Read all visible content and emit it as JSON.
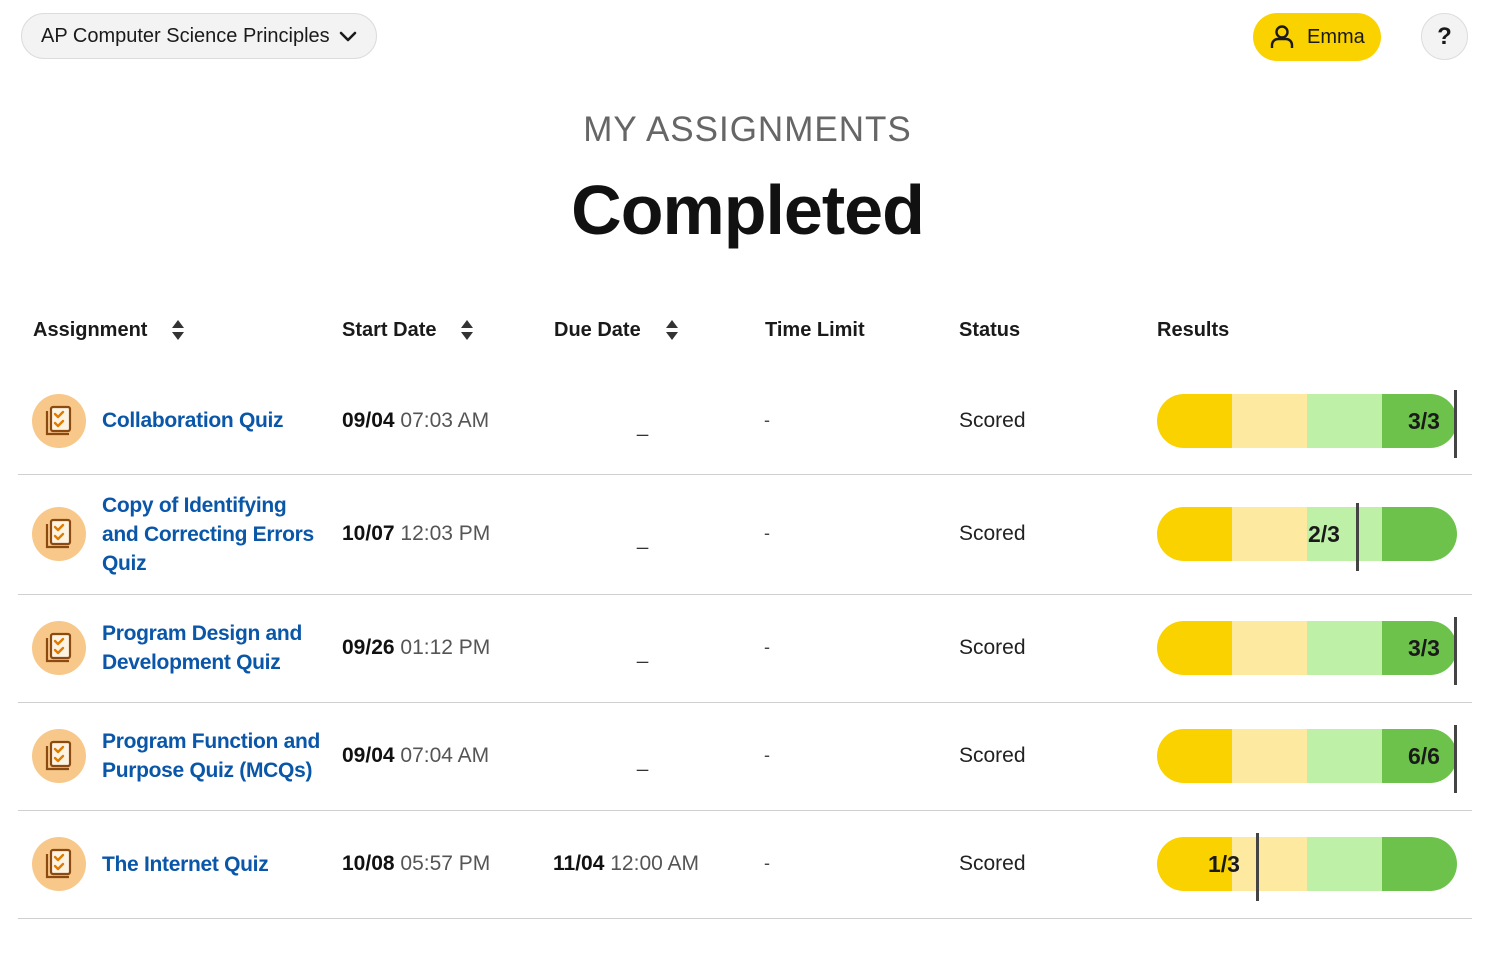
{
  "header": {
    "course": "AP Computer Science Principles",
    "user_name": "Emma",
    "help_label": "?"
  },
  "page": {
    "eyebrow": "MY ASSIGNMENTS",
    "title": "Completed"
  },
  "columns": {
    "assignment": "Assignment",
    "start_date": "Start Date",
    "due_date": "Due Date",
    "time_limit": "Time Limit",
    "status": "Status",
    "results": "Results"
  },
  "colors": {
    "accent_yellow": "#fad200",
    "link_blue": "#0a56a8",
    "bar_segments": [
      "#fad200",
      "#fdeaa0",
      "#bff0a8",
      "#6cc24a"
    ]
  },
  "rows": [
    {
      "title": "Collaboration Quiz",
      "start_day": "09/04",
      "start_time": "07:03 AM",
      "due_day": "",
      "due_time": "",
      "due_blank": "_",
      "time_limit": "-",
      "status": "Scored",
      "score": "3/3",
      "fraction": 1.0
    },
    {
      "title": "Copy of Identifying and Correcting Errors Quiz",
      "start_day": "10/07",
      "start_time": "12:03 PM",
      "due_day": "",
      "due_time": "",
      "due_blank": "_",
      "time_limit": "-",
      "status": "Scored",
      "score": "2/3",
      "fraction": 0.6667
    },
    {
      "title": "Program Design and Development Quiz",
      "start_day": "09/26",
      "start_time": "01:12 PM",
      "due_day": "",
      "due_time": "",
      "due_blank": "_",
      "time_limit": "-",
      "status": "Scored",
      "score": "3/3",
      "fraction": 1.0
    },
    {
      "title": "Program Function and Purpose Quiz (MCQs)",
      "start_day": "09/04",
      "start_time": "07:04 AM",
      "due_day": "",
      "due_time": "",
      "due_blank": "_",
      "time_limit": "-",
      "status": "Scored",
      "score": "6/6",
      "fraction": 1.0
    },
    {
      "title": "The Internet Quiz",
      "start_day": "10/08",
      "start_time": "05:57 PM",
      "due_day": "11/04",
      "due_time": "12:00 AM",
      "due_blank": "",
      "time_limit": "-",
      "status": "Scored",
      "score": "1/3",
      "fraction": 0.3333
    }
  ]
}
